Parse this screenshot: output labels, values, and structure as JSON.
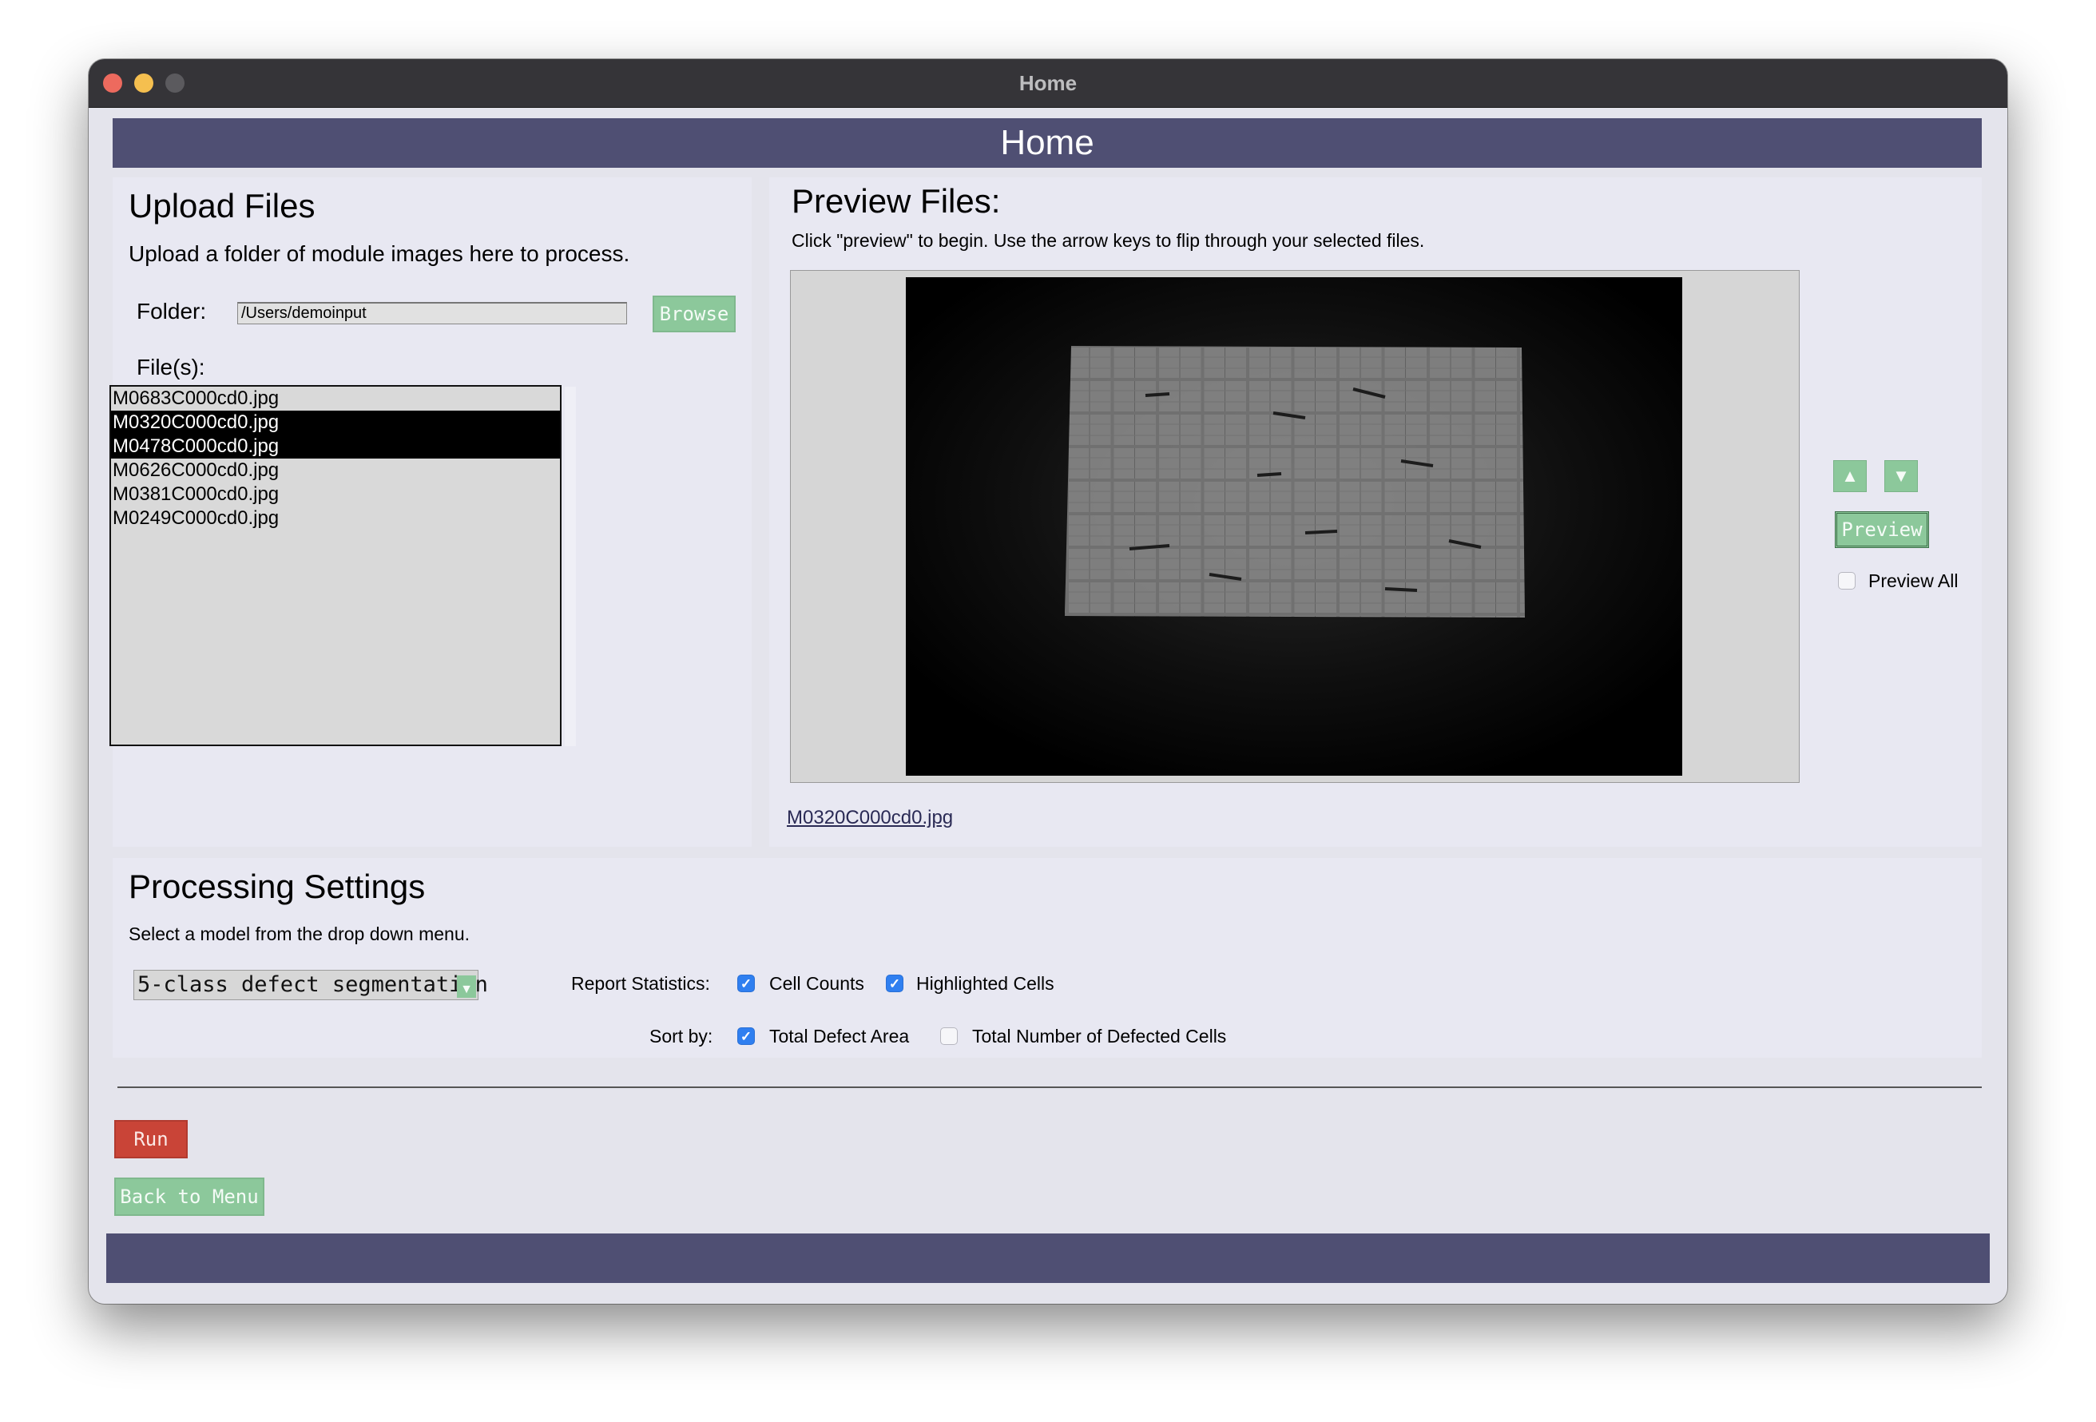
{
  "window": {
    "title": "Home"
  },
  "header": {
    "title": "Home"
  },
  "upload": {
    "title": "Upload Files",
    "description": "Upload a folder of module images here to process.",
    "folder_label": "Folder:",
    "folder_value": "/Users/demoinput",
    "browse_label": "Browse",
    "files_label": "File(s):",
    "files": [
      {
        "name": "M0683C000cd0.jpg",
        "selected": false
      },
      {
        "name": "M0320C000cd0.jpg",
        "selected": true
      },
      {
        "name": "M0478C000cd0.jpg",
        "selected": true
      },
      {
        "name": "M0626C000cd0.jpg",
        "selected": false
      },
      {
        "name": "M0381C000cd0.jpg",
        "selected": false
      },
      {
        "name": "M0249C000cd0.jpg",
        "selected": false
      }
    ]
  },
  "preview": {
    "title": "Preview Files:",
    "instructions": "Click \"preview\" to begin. Use the arrow keys to flip through your selected files.",
    "up_icon": "triangle-up-icon",
    "down_icon": "triangle-down-icon",
    "preview_button": "Preview",
    "preview_all_label": "Preview All",
    "preview_all_checked": false,
    "current_file": "M0320C000cd0.jpg"
  },
  "processing": {
    "title": "Processing Settings",
    "description": "Select a model from the drop down menu.",
    "model_selected": "5-class defect segmentation",
    "report_label": "Report Statistics:",
    "report_options": [
      {
        "label": "Cell Counts",
        "checked": true
      },
      {
        "label": "Highlighted Cells",
        "checked": true
      }
    ],
    "sort_label": "Sort by:",
    "sort_options": [
      {
        "label": "Total Defect Area",
        "checked": true
      },
      {
        "label": "Total Number of Defected Cells",
        "checked": false
      }
    ]
  },
  "actions": {
    "run_label": "Run",
    "back_label": "Back to Menu"
  },
  "colors": {
    "header_bar": "#4f4f73",
    "panel_bg": "#e8e8f2",
    "green_button": "#8cc89b",
    "run_button": "#c94437",
    "checkbox_blue": "#2f7ff0"
  }
}
